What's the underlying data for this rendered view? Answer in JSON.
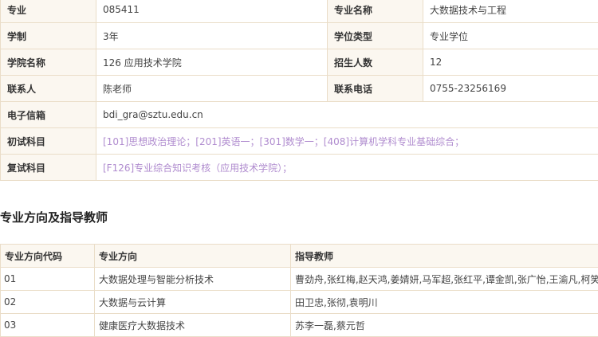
{
  "info": {
    "major_label": "专业",
    "major_code": "085411",
    "major_name_label": "专业名称",
    "major_name": "大数据技术与工程",
    "system_label": "学制",
    "system_value": "3年",
    "degree_type_label": "学位类型",
    "degree_type": "专业学位",
    "college_label": "学院名称",
    "college_value": "126 应用技术学院",
    "enrollment_label": "招生人数",
    "enrollment_value": "12",
    "contact_label": "联系人",
    "contact_value": "陈老师",
    "phone_label": "联系电话",
    "phone_value": "0755-23256169",
    "email_label": "电子信箱",
    "email_value": "bdi_gra@sztu.edu.cn",
    "exam_label": "初试科目",
    "exam_value": "[101]思想政治理论；[201]英语一；[301]数学一；[408]计算机学科专业基础综合；",
    "retest_label": "复试科目",
    "retest_value": "[F126]专业综合知识考核（应用技术学院）；"
  },
  "directions": {
    "title": "专业方向及指导教师",
    "headers": [
      "专业方向代码",
      "专业方向",
      "指导教师"
    ],
    "rows": [
      {
        "code": "01",
        "direction": "大数据处理与智能分析技术",
        "teachers": "曹劲舟,张红梅,赵天鸿,姜婧妍,马军超,张红平,谭金凯,张广怡,王渝凡,柯笑"
      },
      {
        "code": "02",
        "direction": "大数据与云计算",
        "teachers": "田卫忠,张彻,袁明川"
      },
      {
        "code": "03",
        "direction": "健康医疗大数据技术",
        "teachers": "苏李一磊,蔡元哲"
      }
    ]
  }
}
